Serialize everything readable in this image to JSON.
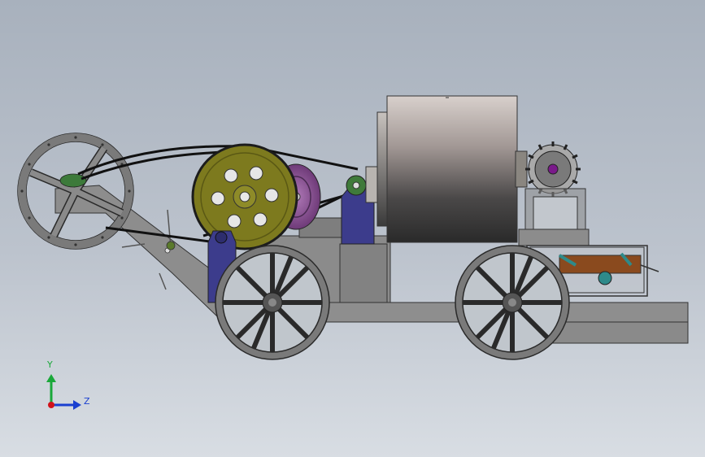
{
  "viewport": {
    "background_top": "#a8b1bd",
    "background_bottom": "#d8dde3"
  },
  "axis_triad": {
    "y_label": "Y",
    "z_label": "Z",
    "y_color": "#1aa83a",
    "z_color": "#1a3fd0",
    "origin_color": "#d0121a"
  },
  "colors": {
    "frame_gray": "#8c8c8c",
    "olive_pulley": "#7d7a1e",
    "purple_pulley": "#8a4a90",
    "navy_bearing": "#3c3c8c",
    "green_pulley": "#3f7a3a",
    "drum_dark": "#2c2c2c",
    "wood_brown": "#8a4a1e",
    "teal_part": "#2e8a8a"
  },
  "icons": [
    "axis-triad-icon",
    "spur-gear-icon",
    "spoked-wheel-icon"
  ]
}
